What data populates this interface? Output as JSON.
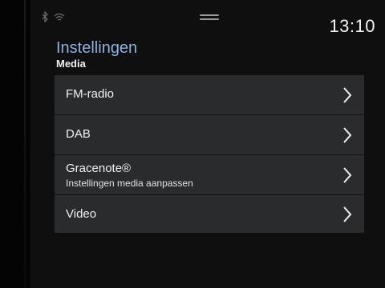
{
  "status": {
    "clock": "13:10",
    "icons": [
      "bluetooth-icon",
      "wifi-icon"
    ]
  },
  "header": {
    "title": "Instellingen",
    "subtitle": "Media"
  },
  "menu": {
    "items": [
      {
        "label": "FM-radio"
      },
      {
        "label": "DAB"
      },
      {
        "label": "Gracenote®",
        "sub": "Instellingen media aanpassen"
      },
      {
        "label": "Video"
      }
    ]
  },
  "colors": {
    "accent": "#8fb0e0",
    "panel": "#2a2b2d",
    "text": "#f2f2f2"
  }
}
